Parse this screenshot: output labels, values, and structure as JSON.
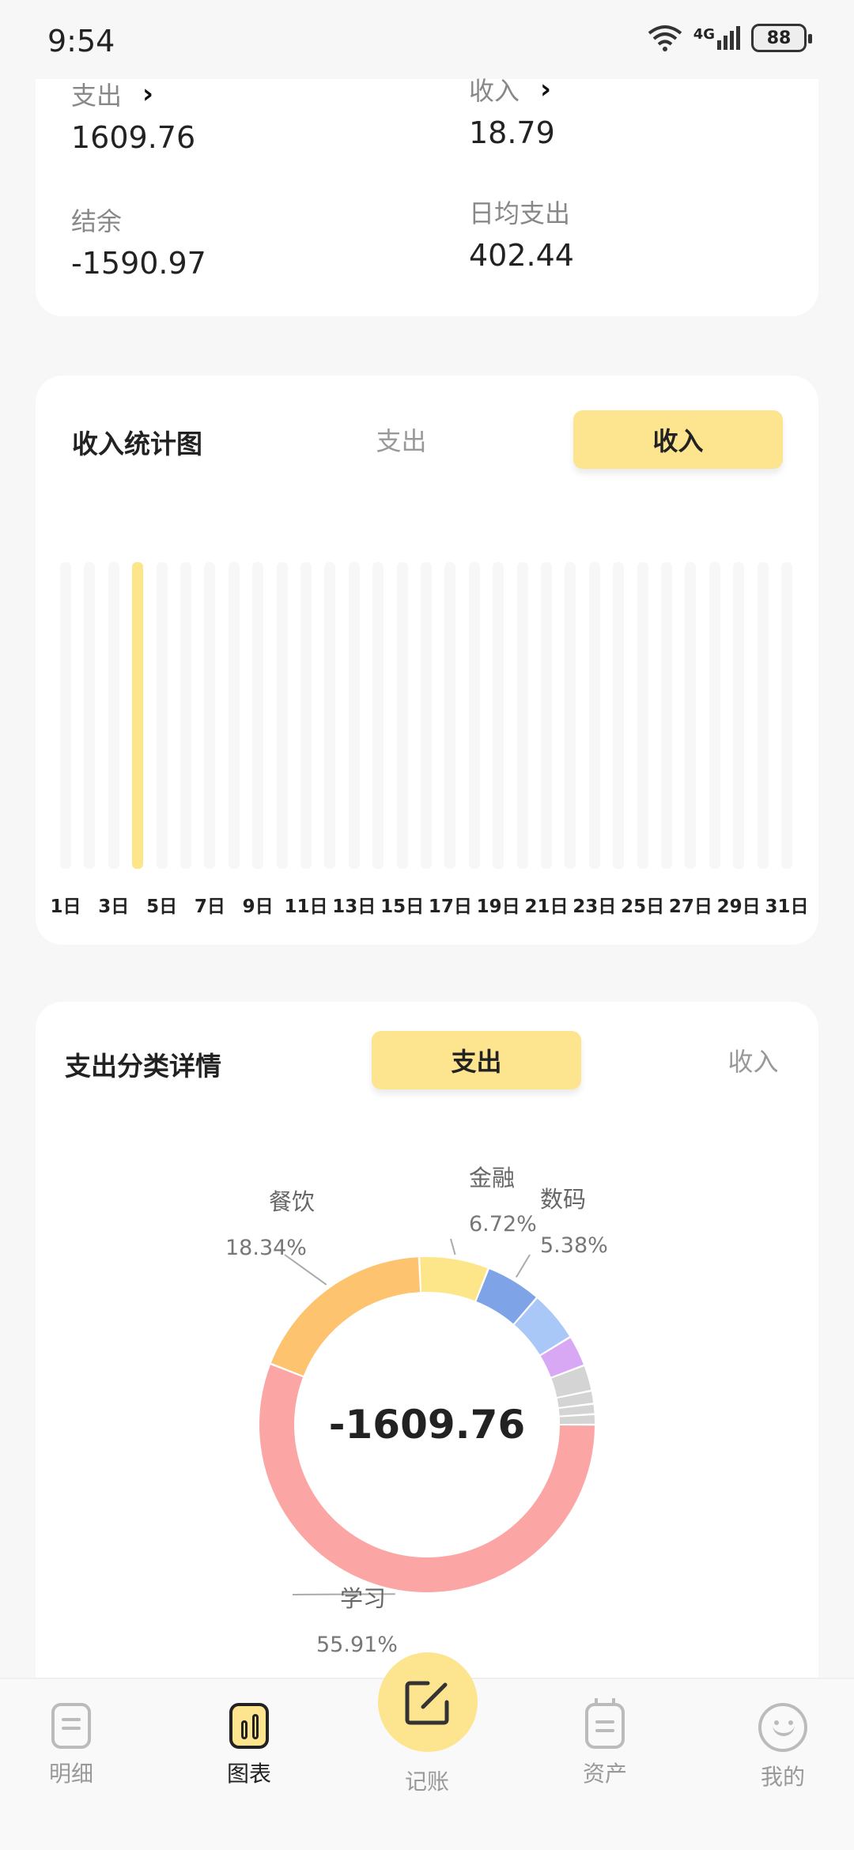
{
  "status_bar": {
    "time": "9:54",
    "network": "4G",
    "battery": "88"
  },
  "summary": {
    "expense_label": "支出",
    "expense_value": "1609.76",
    "income_label": "收入",
    "income_value": "18.79",
    "balance_label": "结余",
    "balance_value": "-1590.97",
    "daily_label": "日均支出",
    "daily_value": "402.44"
  },
  "income_chart": {
    "title": "收入统计图",
    "toggle": {
      "expense_label": "支出",
      "income_label": "收入",
      "active": "income"
    },
    "chart_data": {
      "type": "bar",
      "x": [
        "1日",
        "2日",
        "3日",
        "4日",
        "5日",
        "6日",
        "7日",
        "8日",
        "9日",
        "10日",
        "11日",
        "12日",
        "13日",
        "14日",
        "15日",
        "16日",
        "17日",
        "18日",
        "19日",
        "20日",
        "21日",
        "22日",
        "23日",
        "24日",
        "25日",
        "26日",
        "27日",
        "28日",
        "29日",
        "30日",
        "31日"
      ],
      "tick_labels": [
        "1日",
        "3日",
        "5日",
        "7日",
        "9日",
        "11日",
        "13日",
        "15日",
        "17日",
        "19日",
        "21日",
        "23日",
        "25日",
        "27日",
        "29日",
        "31日"
      ],
      "values": [
        0,
        0,
        0,
        18.79,
        0,
        0,
        0,
        0,
        0,
        0,
        0,
        0,
        0,
        0,
        0,
        0,
        0,
        0,
        0,
        0,
        0,
        0,
        0,
        0,
        0,
        0,
        0,
        0,
        0,
        0,
        0
      ],
      "bar_color": "#fde68a",
      "track_color": "#f7f7f7"
    }
  },
  "expense_detail": {
    "title": "支出分类详情",
    "toggle": {
      "expense_label": "支出",
      "income_label": "收入",
      "active": "expense"
    },
    "center_value": "-1609.76",
    "chart_data": {
      "type": "pie",
      "slices": [
        {
          "label": "学习",
          "percent": "55.91%",
          "value": 55.91,
          "color": "#fca5a5"
        },
        {
          "label": "餐饮",
          "percent": "18.34%",
          "value": 18.34,
          "color": "#fdc36e"
        },
        {
          "label": "金融",
          "percent": "6.72%",
          "value": 6.72,
          "color": "#fde68a"
        },
        {
          "label": "数码",
          "percent": "5.38%",
          "value": 5.38,
          "color": "#7ea3e6"
        },
        {
          "label": "",
          "percent": "",
          "value": 4.9,
          "color": "#a9c8f8"
        },
        {
          "label": "",
          "percent": "",
          "value": 3.0,
          "color": "#d8a8f5"
        },
        {
          "label": "",
          "percent": "",
          "value": 2.5,
          "color": "#d4d4d4"
        },
        {
          "label": "",
          "percent": "",
          "value": 1.25,
          "color": "#d4d4d4"
        },
        {
          "label": "",
          "percent": "",
          "value": 1.0,
          "color": "#d4d4d4"
        },
        {
          "label": "",
          "percent": "",
          "value": 1.0,
          "color": "#d4d4d4"
        }
      ]
    }
  },
  "bottom_nav": {
    "items": [
      {
        "label": "明细",
        "icon": "list-icon"
      },
      {
        "label": "图表",
        "icon": "chart-icon",
        "active": true
      },
      {
        "label": "记账",
        "icon": "edit-icon"
      },
      {
        "label": "资产",
        "icon": "calendar-icon"
      },
      {
        "label": "我的",
        "icon": "smile-icon"
      }
    ]
  },
  "colors": {
    "accent": "#fde48e",
    "background": "#f7f7f7"
  }
}
